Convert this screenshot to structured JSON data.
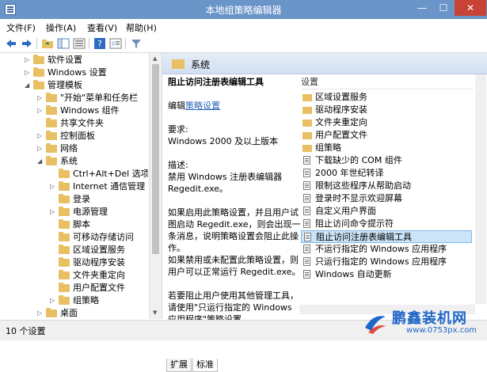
{
  "window": {
    "title": "本地组策略编辑器",
    "min": "—",
    "max": "☐",
    "close": "✕"
  },
  "menu": [
    "文件(F)",
    "操作(A)",
    "查看(V)",
    "帮助(H)"
  ],
  "tree": [
    {
      "label": "软件设置",
      "depth": 2,
      "arrow": "▷"
    },
    {
      "label": "Windows 设置",
      "depth": 2,
      "arrow": "▷"
    },
    {
      "label": "管理模板",
      "depth": 2,
      "arrow": "◢"
    },
    {
      "label": "\"开始\"菜单和任务栏",
      "depth": 3,
      "arrow": "▷"
    },
    {
      "label": "Windows 组件",
      "depth": 3,
      "arrow": "▷"
    },
    {
      "label": "共享文件夹",
      "depth": 3,
      "arrow": ""
    },
    {
      "label": "控制面板",
      "depth": 3,
      "arrow": "▷"
    },
    {
      "label": "网络",
      "depth": 3,
      "arrow": "▷"
    },
    {
      "label": "系统",
      "depth": 3,
      "arrow": "◢"
    },
    {
      "label": "Ctrl+Alt+Del 选项",
      "depth": 4,
      "arrow": ""
    },
    {
      "label": "Internet 通信管理",
      "depth": 4,
      "arrow": "▷"
    },
    {
      "label": "登录",
      "depth": 4,
      "arrow": ""
    },
    {
      "label": "电源管理",
      "depth": 4,
      "arrow": "▷"
    },
    {
      "label": "脚本",
      "depth": 4,
      "arrow": ""
    },
    {
      "label": "可移动存储访问",
      "depth": 4,
      "arrow": ""
    },
    {
      "label": "区域设置服务",
      "depth": 4,
      "arrow": ""
    },
    {
      "label": "驱动程序安装",
      "depth": 4,
      "arrow": ""
    },
    {
      "label": "文件夹重定向",
      "depth": 4,
      "arrow": ""
    },
    {
      "label": "用户配置文件",
      "depth": 4,
      "arrow": ""
    },
    {
      "label": "组策略",
      "depth": 4,
      "arrow": "▷"
    },
    {
      "label": "桌面",
      "depth": 3,
      "arrow": "▷"
    }
  ],
  "section": {
    "title": "系统"
  },
  "description": {
    "policy_title": "阻止访问注册表编辑工具",
    "edit_prefix": "编辑",
    "edit_link": "策略设置",
    "req_label": "要求:",
    "req_value": "Windows 2000 及以上版本",
    "desc_label": "描述:",
    "desc_line1": "禁用 Windows 注册表编辑器",
    "desc_line2": "Regedit.exe。",
    "para1": "如果启用此策略设置，并且用户试图启动 Regedit.exe，则会出现一条消息，说明策略设置会阻止此操作。",
    "para2": "如果禁用或未配置此策略设置，则用户可以正常运行 Regedit.exe。",
    "para3": "若要阻止用户使用其他管理工具，请使用\"只运行指定的 Windows 应用程序\"策略设置。"
  },
  "list": {
    "header": "设置",
    "items": [
      {
        "label": "区域设置服务",
        "kind": "folder"
      },
      {
        "label": "驱动程序安装",
        "kind": "folder"
      },
      {
        "label": "文件夹重定向",
        "kind": "folder"
      },
      {
        "label": "用户配置文件",
        "kind": "folder"
      },
      {
        "label": "组策略",
        "kind": "folder"
      },
      {
        "label": "下载缺少的 COM 组件",
        "kind": "policy"
      },
      {
        "label": "2000 年世纪转译",
        "kind": "policy"
      },
      {
        "label": "限制这些程序从帮助启动",
        "kind": "policy"
      },
      {
        "label": "登录时不显示欢迎屏幕",
        "kind": "policy"
      },
      {
        "label": "自定义用户界面",
        "kind": "policy"
      },
      {
        "label": "阻止访问命令提示符",
        "kind": "policy"
      },
      {
        "label": "阻止访问注册表编辑工具",
        "kind": "policy",
        "selected": true
      },
      {
        "label": "不运行指定的 Windows 应用程序",
        "kind": "policy"
      },
      {
        "label": "只运行指定的 Windows 应用程序",
        "kind": "policy"
      },
      {
        "label": "Windows 自动更新",
        "kind": "policy"
      }
    ]
  },
  "tabs": [
    "扩展",
    "标准"
  ],
  "status": {
    "text": "10 个设置"
  },
  "watermark": {
    "title": "鹏鑫装机网",
    "url": "www.0753px.com"
  }
}
